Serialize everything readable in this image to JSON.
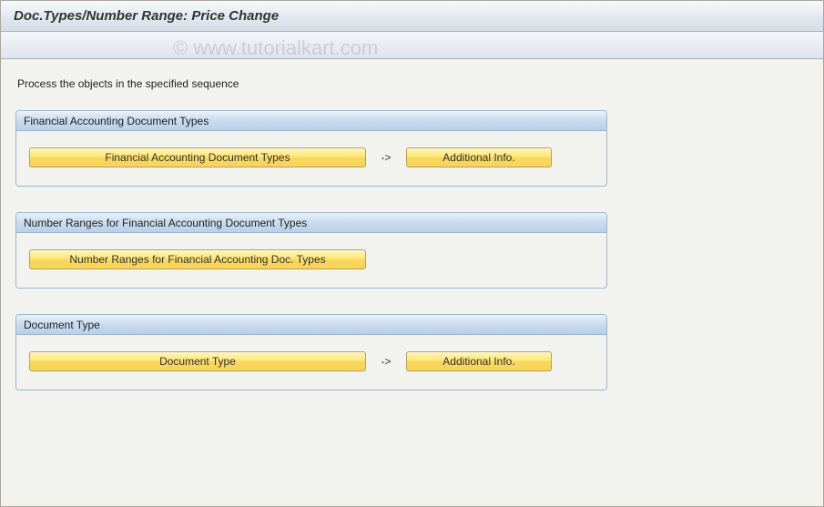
{
  "header": {
    "title": "Doc.Types/Number Range: Price Change"
  },
  "instruction_text": "Process the objects in the specified sequence",
  "groups": [
    {
      "title": "Financial Accounting Document Types",
      "main_button": "Financial Accounting Document Types",
      "arrow": "->",
      "info_button": "Additional Info."
    },
    {
      "title": "Number Ranges for Financial Accounting Document Types",
      "main_button": "Number Ranges for Financial Accounting Doc. Types",
      "arrow": "",
      "info_button": ""
    },
    {
      "title": "Document Type",
      "main_button": "Document Type",
      "arrow": "->",
      "info_button": "Additional Info."
    }
  ],
  "watermark": "© www.tutorialkart.com"
}
